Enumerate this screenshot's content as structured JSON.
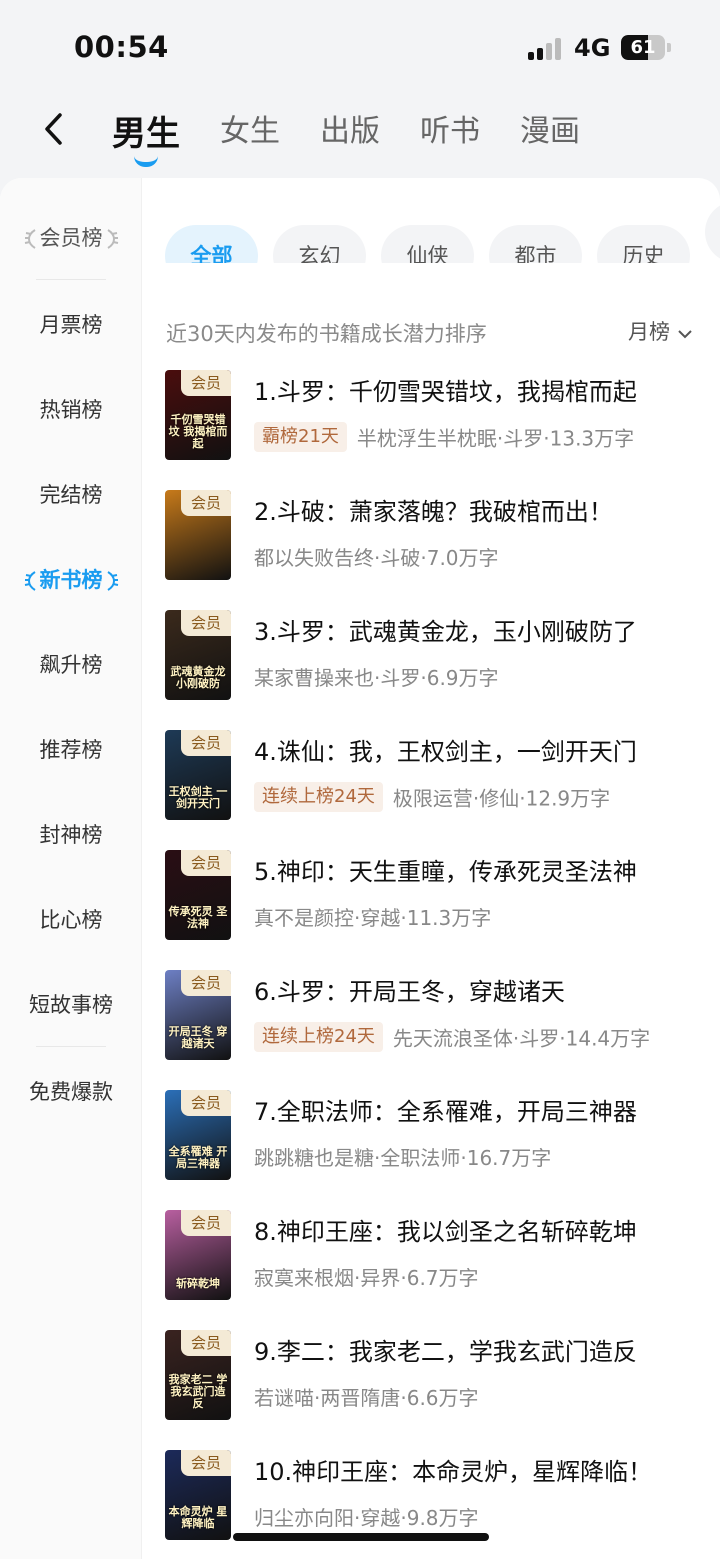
{
  "status": {
    "time": "00:54",
    "network": "4G",
    "battery": "61",
    "battery_level": 0.61
  },
  "header": {
    "tabs": [
      {
        "label": "男生",
        "active": true
      },
      {
        "label": "女生",
        "active": false
      },
      {
        "label": "出版",
        "active": false
      },
      {
        "label": "听书",
        "active": false
      },
      {
        "label": "漫画",
        "active": false
      }
    ]
  },
  "sidebar": {
    "items": [
      {
        "label": "会员榜"
      },
      {
        "label": "月票榜"
      },
      {
        "label": "热销榜"
      },
      {
        "label": "完结榜"
      },
      {
        "label": "新书榜"
      },
      {
        "label": "飙升榜"
      },
      {
        "label": "推荐榜"
      },
      {
        "label": "封神榜"
      },
      {
        "label": "比心榜"
      },
      {
        "label": "短故事榜"
      },
      {
        "label": "免费爆款"
      }
    ]
  },
  "chips": [
    "全部",
    "玄幻",
    "仙侠",
    "都市",
    "历史"
  ],
  "list_desc": "近30天内发布的书籍成长潜力排序",
  "sort_label": "月榜",
  "vip_label": "会员",
  "books": [
    {
      "title": "1.斗罗：千仞雪哭错坟，我揭棺而起",
      "tag": "霸榜21天",
      "meta": "半枕浮生半枕眠·斗罗·13.3万字",
      "cover_text": "千仞雪哭错坟 我揭棺而起",
      "cover_color": "#4a0d0d"
    },
    {
      "title": "2.斗破：萧家落魄？我破棺而出！",
      "tag": "",
      "meta": "都以失败告终·斗破·7.0万字",
      "cover_text": "",
      "cover_color": "#c77a1a"
    },
    {
      "title": "3.斗罗：武魂黄金龙，玉小刚破防了",
      "tag": "",
      "meta": "某家曹操来也·斗罗·6.9万字",
      "cover_text": "武魂黄金龙 小刚破防",
      "cover_color": "#3b2a1c"
    },
    {
      "title": "4.诛仙：我，王权剑主，一剑开天门",
      "tag": "连续上榜24天",
      "meta": "极限运营·修仙·12.9万字",
      "cover_text": "王权剑主 一剑开天门",
      "cover_color": "#1e3a56"
    },
    {
      "title": "5.神印：天生重瞳，传承死灵圣法神",
      "tag": "",
      "meta": "真不是颜控·穿越·11.3万字",
      "cover_text": "传承死灵 圣法神",
      "cover_color": "#2a0e14"
    },
    {
      "title": "6.斗罗：开局王冬，穿越诸天",
      "tag": "连续上榜24天",
      "meta": "先天流浪圣体·斗罗·14.4万字",
      "cover_text": "开局王冬 穿越诸天",
      "cover_color": "#6d7fc4"
    },
    {
      "title": "7.全职法师：全系罹难，开局三神器",
      "tag": "",
      "meta": "跳跳糖也是糖·全职法师·16.7万字",
      "cover_text": "全系罹难 开局三神器",
      "cover_color": "#2b6fb8"
    },
    {
      "title": "8.神印王座：我以剑圣之名斩碎乾坤",
      "tag": "",
      "meta": "寂寞来根烟·异界·6.7万字",
      "cover_text": "斩碎乾坤",
      "cover_color": "#b85fa0"
    },
    {
      "title": "9.李二：我家老二，学我玄武门造反",
      "tag": "",
      "meta": "若谜喵·两晋隋唐·6.6万字",
      "cover_text": "我家老二 学我玄武门造反",
      "cover_color": "#3a2320"
    },
    {
      "title": "10.神印王座：本命灵炉，星辉降临！",
      "tag": "",
      "meta": "归尘亦向阳·穿越·9.8万字",
      "cover_text": "本命灵炉 星辉降临",
      "cover_color": "#1c2a5a"
    }
  ],
  "colors": {
    "accent": "#1a9cf0",
    "tag_bg": "#f8efe8",
    "tag_text": "#b0683c",
    "vip_bg": "#f4ead6"
  }
}
